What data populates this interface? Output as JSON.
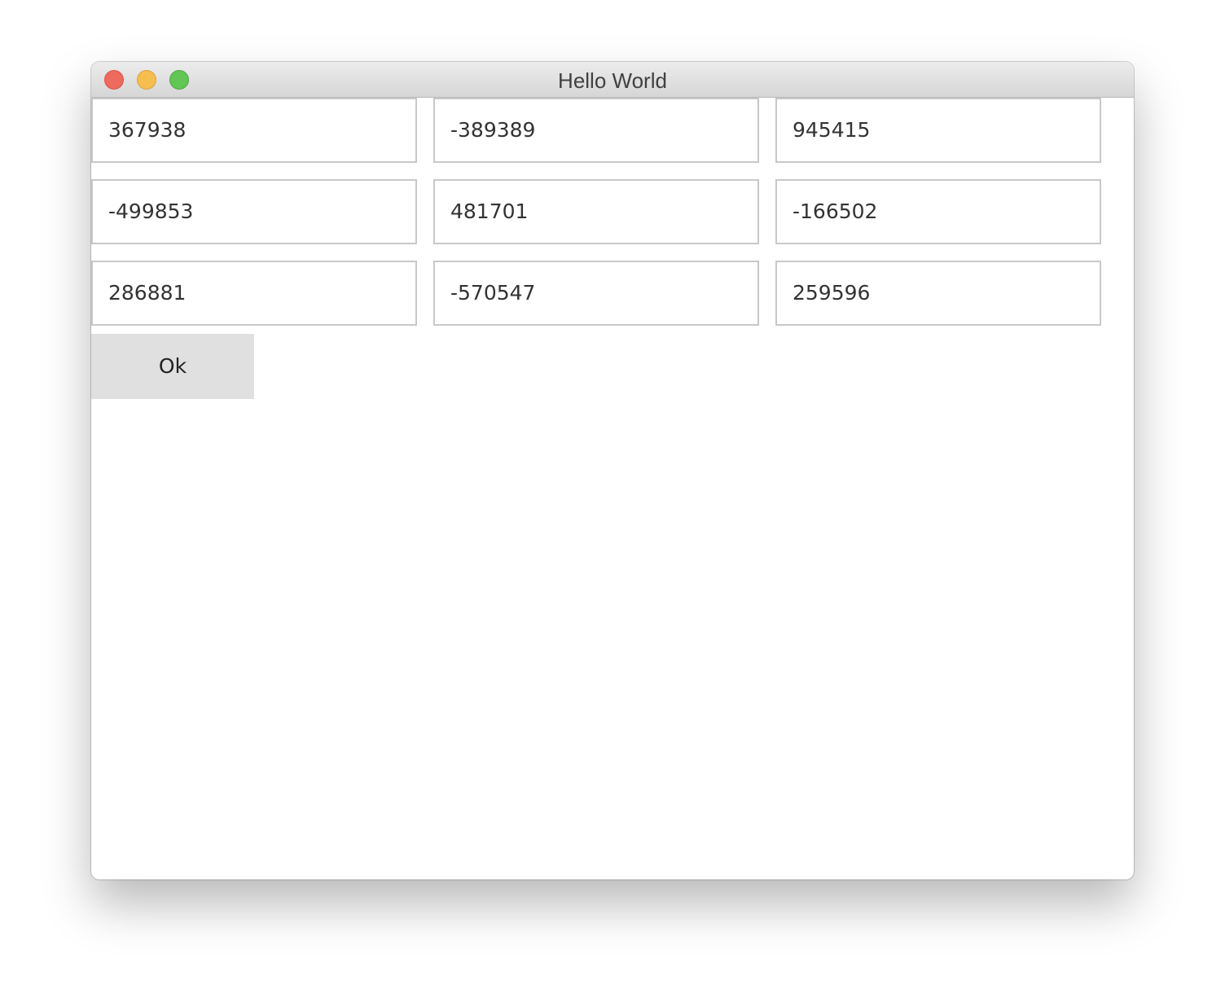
{
  "window": {
    "title": "Hello World"
  },
  "grid": {
    "rows": [
      [
        "367938",
        "-389389",
        "945415"
      ],
      [
        "-499853",
        "481701",
        "-166502"
      ],
      [
        "286881",
        "-570547",
        "259596"
      ]
    ]
  },
  "ok_button": {
    "label": "Ok"
  },
  "colors": {
    "close": "#ee6a5f",
    "minimize": "#f5be4f",
    "zoom": "#62c655",
    "button_bg": "#e0e0e0",
    "field_border": "#c8c8c8"
  }
}
